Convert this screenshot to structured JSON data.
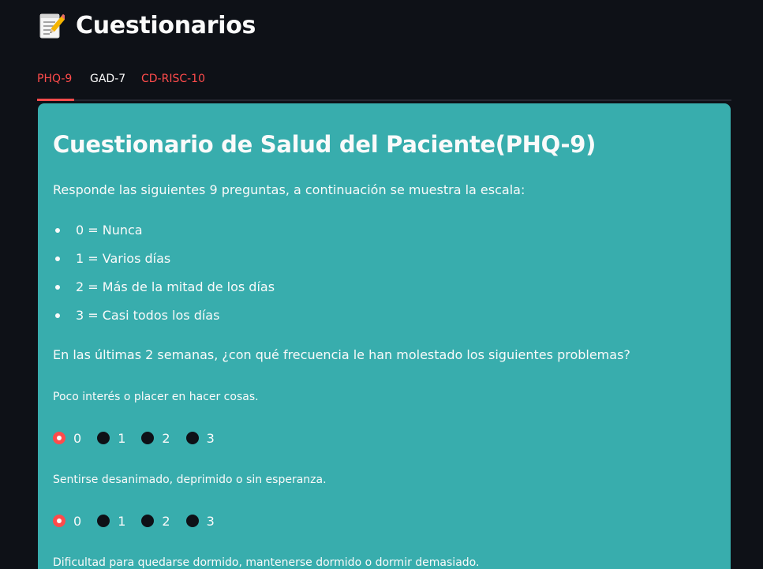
{
  "app": {
    "title": "Cuestionarios",
    "title_icon": "memo-icon"
  },
  "tabs": [
    {
      "label": "PHQ-9",
      "active": true
    },
    {
      "label": "GAD-7",
      "active": false
    },
    {
      "label": "CD-RISC-10",
      "active": false
    }
  ],
  "colors": {
    "background": "#0e1117",
    "card": "#38adad",
    "accent": "#ff4b4b",
    "text": "#fafafa"
  },
  "card": {
    "title": "Cuestionario de Salud del Paciente(PHQ-9)",
    "intro": "Responde las siguientes 9 preguntas, a continuación se muestra la escala:",
    "scale": [
      "0 = Nunca",
      "1 = Varios días",
      "2 = Más de la mitad de los días",
      "3 = Casi todos los días"
    ],
    "question_heading": "En las últimas 2 semanas, ¿con qué frecuencia le han molestado los siguientes problemas?",
    "questions": [
      {
        "label": "Poco interés o placer en hacer cosas.",
        "options": [
          "0",
          "1",
          "2",
          "3"
        ],
        "selected": "0"
      },
      {
        "label": "Sentirse desanimado, deprimido o sin esperanza.",
        "options": [
          "0",
          "1",
          "2",
          "3"
        ],
        "selected": "0"
      },
      {
        "label": "Dificultad para quedarse dormido, mantenerse dormido o dormir demasiado."
      }
    ]
  }
}
